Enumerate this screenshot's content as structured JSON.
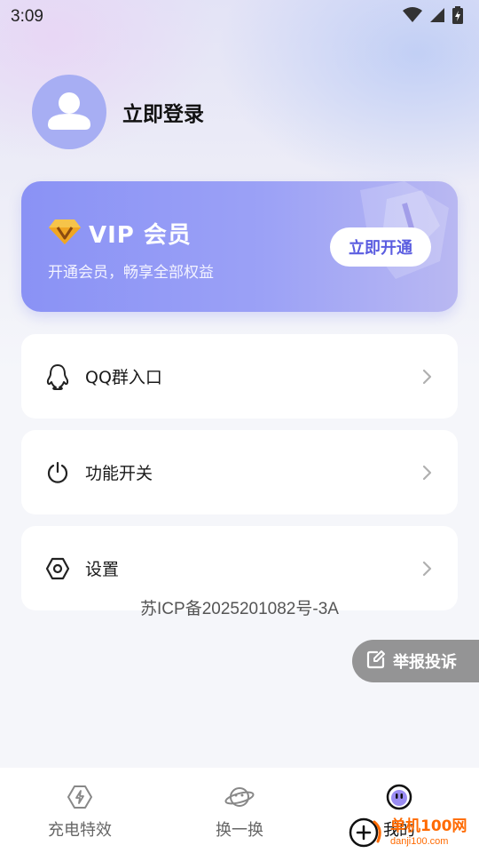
{
  "status_bar": {
    "time": "3:09",
    "icons": [
      "wifi-icon",
      "signal-icon",
      "battery-icon"
    ]
  },
  "profile": {
    "avatar_icon": "user-avatar-icon",
    "login_label": "立即登录"
  },
  "vip": {
    "icon": "diamond-icon",
    "title": "VIP 会员",
    "subtitle": "开通会员，畅享全部权益",
    "button_label": "立即开通",
    "colors": {
      "card": "#8a92f5",
      "button_text": "#5b5de0"
    }
  },
  "menu": {
    "items": [
      {
        "label": "QQ群入口",
        "icon": "qq-penguin-icon"
      },
      {
        "label": "功能开关",
        "icon": "power-icon"
      },
      {
        "label": "设置",
        "icon": "settings-hex-icon"
      }
    ]
  },
  "icp_text": "苏ICP备2025201082号-3A",
  "report": {
    "label": "举报投诉",
    "icon": "edit-icon"
  },
  "tabs": [
    {
      "label": "充电特效",
      "icon": "charge-effect-icon",
      "active": false
    },
    {
      "label": "换一换",
      "icon": "planet-icon",
      "active": false
    },
    {
      "label": "我的",
      "icon": "mine-face-icon",
      "active": true
    }
  ],
  "watermark": {
    "cn": "单机100网",
    "en": "danji100.com",
    "icon": "plus-logo-icon"
  }
}
